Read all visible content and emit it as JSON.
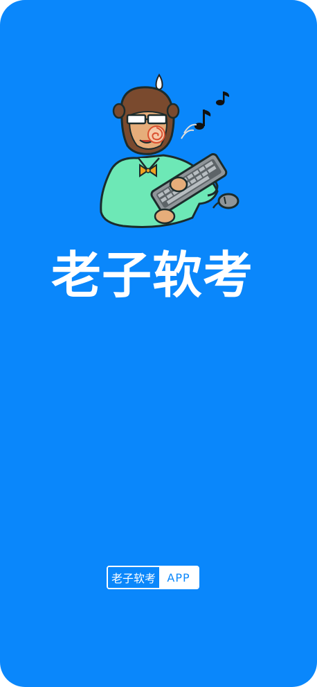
{
  "app": {
    "title": "老子软考"
  },
  "badge": {
    "name": "老子软考",
    "suffix": "APP"
  },
  "theme": {
    "background": "#0a87fb",
    "foreground": "#ffffff"
  },
  "illustration": {
    "subject": "monkey-mascot-with-keyboard-icon"
  }
}
